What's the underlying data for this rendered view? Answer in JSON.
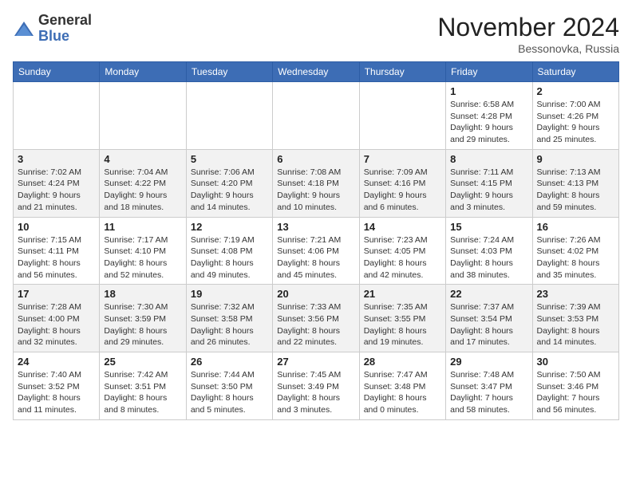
{
  "header": {
    "logo_text_top": "General",
    "logo_text_bottom": "Blue",
    "month_title": "November 2024",
    "location": "Bessonovka, Russia"
  },
  "weekdays": [
    "Sunday",
    "Monday",
    "Tuesday",
    "Wednesday",
    "Thursday",
    "Friday",
    "Saturday"
  ],
  "weeks": [
    [
      {
        "day": "",
        "info": ""
      },
      {
        "day": "",
        "info": ""
      },
      {
        "day": "",
        "info": ""
      },
      {
        "day": "",
        "info": ""
      },
      {
        "day": "",
        "info": ""
      },
      {
        "day": "1",
        "info": "Sunrise: 6:58 AM\nSunset: 4:28 PM\nDaylight: 9 hours and 29 minutes."
      },
      {
        "day": "2",
        "info": "Sunrise: 7:00 AM\nSunset: 4:26 PM\nDaylight: 9 hours and 25 minutes."
      }
    ],
    [
      {
        "day": "3",
        "info": "Sunrise: 7:02 AM\nSunset: 4:24 PM\nDaylight: 9 hours and 21 minutes."
      },
      {
        "day": "4",
        "info": "Sunrise: 7:04 AM\nSunset: 4:22 PM\nDaylight: 9 hours and 18 minutes."
      },
      {
        "day": "5",
        "info": "Sunrise: 7:06 AM\nSunset: 4:20 PM\nDaylight: 9 hours and 14 minutes."
      },
      {
        "day": "6",
        "info": "Sunrise: 7:08 AM\nSunset: 4:18 PM\nDaylight: 9 hours and 10 minutes."
      },
      {
        "day": "7",
        "info": "Sunrise: 7:09 AM\nSunset: 4:16 PM\nDaylight: 9 hours and 6 minutes."
      },
      {
        "day": "8",
        "info": "Sunrise: 7:11 AM\nSunset: 4:15 PM\nDaylight: 9 hours and 3 minutes."
      },
      {
        "day": "9",
        "info": "Sunrise: 7:13 AM\nSunset: 4:13 PM\nDaylight: 8 hours and 59 minutes."
      }
    ],
    [
      {
        "day": "10",
        "info": "Sunrise: 7:15 AM\nSunset: 4:11 PM\nDaylight: 8 hours and 56 minutes."
      },
      {
        "day": "11",
        "info": "Sunrise: 7:17 AM\nSunset: 4:10 PM\nDaylight: 8 hours and 52 minutes."
      },
      {
        "day": "12",
        "info": "Sunrise: 7:19 AM\nSunset: 4:08 PM\nDaylight: 8 hours and 49 minutes."
      },
      {
        "day": "13",
        "info": "Sunrise: 7:21 AM\nSunset: 4:06 PM\nDaylight: 8 hours and 45 minutes."
      },
      {
        "day": "14",
        "info": "Sunrise: 7:23 AM\nSunset: 4:05 PM\nDaylight: 8 hours and 42 minutes."
      },
      {
        "day": "15",
        "info": "Sunrise: 7:24 AM\nSunset: 4:03 PM\nDaylight: 8 hours and 38 minutes."
      },
      {
        "day": "16",
        "info": "Sunrise: 7:26 AM\nSunset: 4:02 PM\nDaylight: 8 hours and 35 minutes."
      }
    ],
    [
      {
        "day": "17",
        "info": "Sunrise: 7:28 AM\nSunset: 4:00 PM\nDaylight: 8 hours and 32 minutes."
      },
      {
        "day": "18",
        "info": "Sunrise: 7:30 AM\nSunset: 3:59 PM\nDaylight: 8 hours and 29 minutes."
      },
      {
        "day": "19",
        "info": "Sunrise: 7:32 AM\nSunset: 3:58 PM\nDaylight: 8 hours and 26 minutes."
      },
      {
        "day": "20",
        "info": "Sunrise: 7:33 AM\nSunset: 3:56 PM\nDaylight: 8 hours and 22 minutes."
      },
      {
        "day": "21",
        "info": "Sunrise: 7:35 AM\nSunset: 3:55 PM\nDaylight: 8 hours and 19 minutes."
      },
      {
        "day": "22",
        "info": "Sunrise: 7:37 AM\nSunset: 3:54 PM\nDaylight: 8 hours and 17 minutes."
      },
      {
        "day": "23",
        "info": "Sunrise: 7:39 AM\nSunset: 3:53 PM\nDaylight: 8 hours and 14 minutes."
      }
    ],
    [
      {
        "day": "24",
        "info": "Sunrise: 7:40 AM\nSunset: 3:52 PM\nDaylight: 8 hours and 11 minutes."
      },
      {
        "day": "25",
        "info": "Sunrise: 7:42 AM\nSunset: 3:51 PM\nDaylight: 8 hours and 8 minutes."
      },
      {
        "day": "26",
        "info": "Sunrise: 7:44 AM\nSunset: 3:50 PM\nDaylight: 8 hours and 5 minutes."
      },
      {
        "day": "27",
        "info": "Sunrise: 7:45 AM\nSunset: 3:49 PM\nDaylight: 8 hours and 3 minutes."
      },
      {
        "day": "28",
        "info": "Sunrise: 7:47 AM\nSunset: 3:48 PM\nDaylight: 8 hours and 0 minutes."
      },
      {
        "day": "29",
        "info": "Sunrise: 7:48 AM\nSunset: 3:47 PM\nDaylight: 7 hours and 58 minutes."
      },
      {
        "day": "30",
        "info": "Sunrise: 7:50 AM\nSunset: 3:46 PM\nDaylight: 7 hours and 56 minutes."
      }
    ]
  ]
}
